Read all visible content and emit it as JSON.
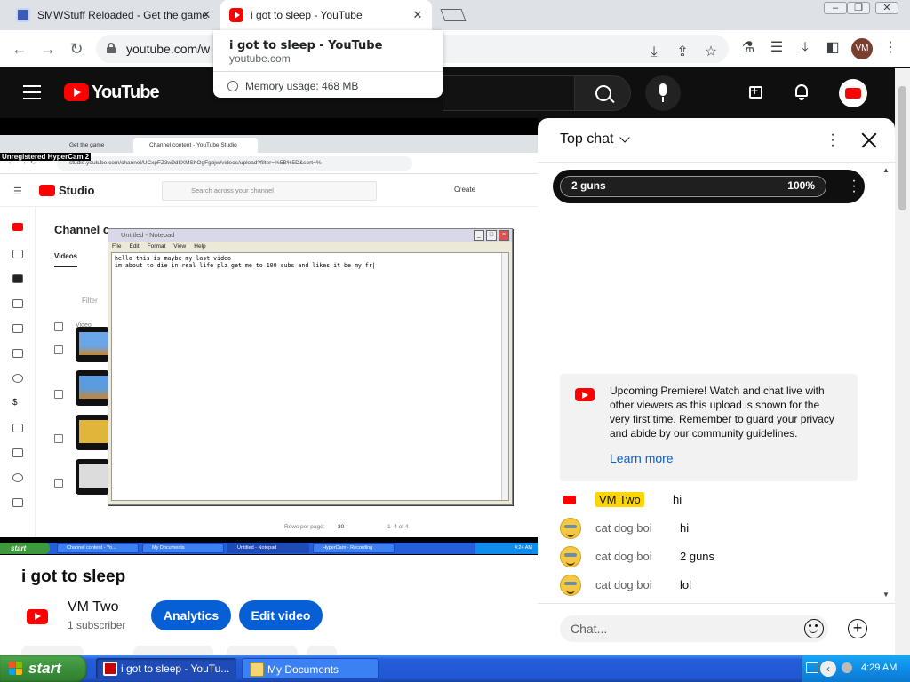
{
  "browser": {
    "tabs": [
      {
        "title": "SMWStuff Reloaded - Get the game",
        "icon": "smwstuff-favicon"
      },
      {
        "title": "i got to sleep - YouTube",
        "icon": "youtube-favicon"
      }
    ],
    "tab_close_glyph": "✕",
    "url": "youtube.com/w",
    "profile_initials": "VM",
    "hover_card": {
      "title": "i got to sleep - YouTube",
      "domain": "youtube.com",
      "memory": "Memory usage: 468 MB"
    }
  },
  "masthead": {
    "logo_text": "YouTube"
  },
  "recording": {
    "watermark": "Unregistered HyperCam 2",
    "inner_tabs": [
      "Get the game",
      "Channel content - YouTube Studio"
    ],
    "inner_url": "studio.youtube.com/channel/UCxpFZ3w9dIlXMShOgFgbjw/videos/upload?filter=%5B%5D&sort=%",
    "studio_logo_text": "Studio",
    "studio_search_placeholder": "Search across your channel",
    "studio_create": "Create",
    "channel_title": "Channel c",
    "videos_tab": "Videos",
    "filter_label": "Filter",
    "video_column": "Video",
    "rows_per_page_label": "Rows per page:",
    "rows_per_page_value": "30",
    "page_count": "1–4 of 4",
    "notepad": {
      "title": "Untitled - Notepad",
      "menu": [
        "File",
        "Edit",
        "Format",
        "View",
        "Help"
      ],
      "content": "hello this is maybe my last video\nim about to die in real life plz get me to 100 subs and likes it be my fr|"
    },
    "inner_taskbar": {
      "start": "start",
      "tasks": [
        "Channel content - Yo...",
        "My Documents",
        "Untitled - Notepad",
        "HyperCam - Recording"
      ],
      "time": "4:24 AM"
    }
  },
  "video": {
    "title": "i got to sleep",
    "channel_name": "VM Two",
    "subscribers": "1 subscriber",
    "analytics_label": "Analytics",
    "edit_label": "Edit video"
  },
  "chat": {
    "mode_label": "Top chat",
    "poll": {
      "label": "2 guns",
      "percent_text": "100%",
      "percent": 100
    },
    "premiere_notice": "Upcoming Premiere! Watch and chat live with other viewers as this upload is shown for the very first time. Remember to guard your privacy and abide by our community guidelines.",
    "learn_more": "Learn more",
    "messages": [
      {
        "author": "VM Two",
        "text": "hi",
        "owner": true
      },
      {
        "author": "cat dog boi",
        "text": "hi",
        "owner": false
      },
      {
        "author": "cat dog boi",
        "text": "2 guns",
        "owner": false
      },
      {
        "author": "cat dog boi",
        "text": "lol",
        "owner": false
      }
    ],
    "input_placeholder": "Chat..."
  },
  "taskbar": {
    "start_label": "start",
    "tasks": [
      {
        "label": "i got to sleep - YouTu...",
        "active": true
      },
      {
        "label": "My Documents",
        "active": false
      }
    ],
    "clock": "4:29 AM"
  },
  "colors": {
    "youtube_red": "#ff0000",
    "link_blue": "#065fd4",
    "owner_badge": "#ffd600",
    "xp_taskbar": "#245edb",
    "xp_start_green": "#3c8f3c"
  }
}
